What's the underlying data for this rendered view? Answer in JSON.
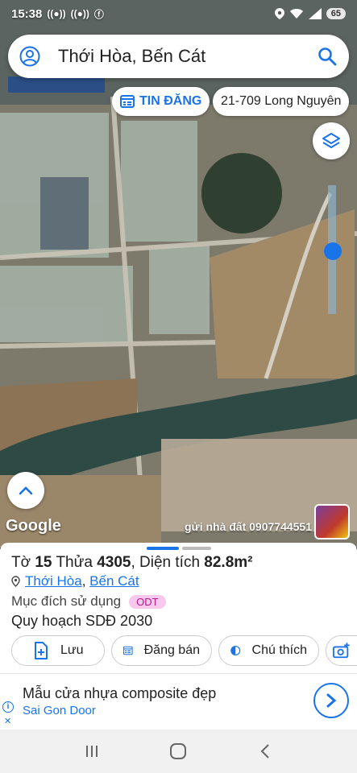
{
  "status": {
    "time": "15:38",
    "battery": "65",
    "left_icons": [
      "wifi-calling-icon",
      "wifi-calling-icon",
      "facebook-icon"
    ],
    "right_icons": [
      "location-icon",
      "wifi-icon",
      "signal-icon"
    ]
  },
  "search": {
    "query": "Thới Hòa, Bến Cát"
  },
  "chips": {
    "tin_dang": "TIN ĐĂNG",
    "address": "21-709 Long Nguyên"
  },
  "map": {
    "google_label": "Google",
    "ad_caption": "gửi nhà đất 0907744551"
  },
  "parcel": {
    "to_label": "Tờ",
    "to_value": "15",
    "thua_label": "Thửa",
    "thua_value": "4305",
    "dien_tich_label": ", Diện tích",
    "dien_tich_value": "82.8m²",
    "ward": "Thới Hòa",
    "separator": ",",
    "district": "Bến Cát",
    "purpose_label": "Mục đích sử dụng",
    "purpose_badge": "ODT",
    "plan": "Quy hoạch SDĐ 2030"
  },
  "actions": {
    "save": "Lưu",
    "post": "Đăng bán",
    "note": "Chú thích"
  },
  "ad": {
    "title": "Mẫu cửa nhựa composite đẹp",
    "brand": "Sai Gon Door",
    "info": "i",
    "close": "✕"
  },
  "colors": {
    "accent": "#1a73e8",
    "badge_bg": "#f8c8ec",
    "badge_fg": "#b01c8b"
  }
}
